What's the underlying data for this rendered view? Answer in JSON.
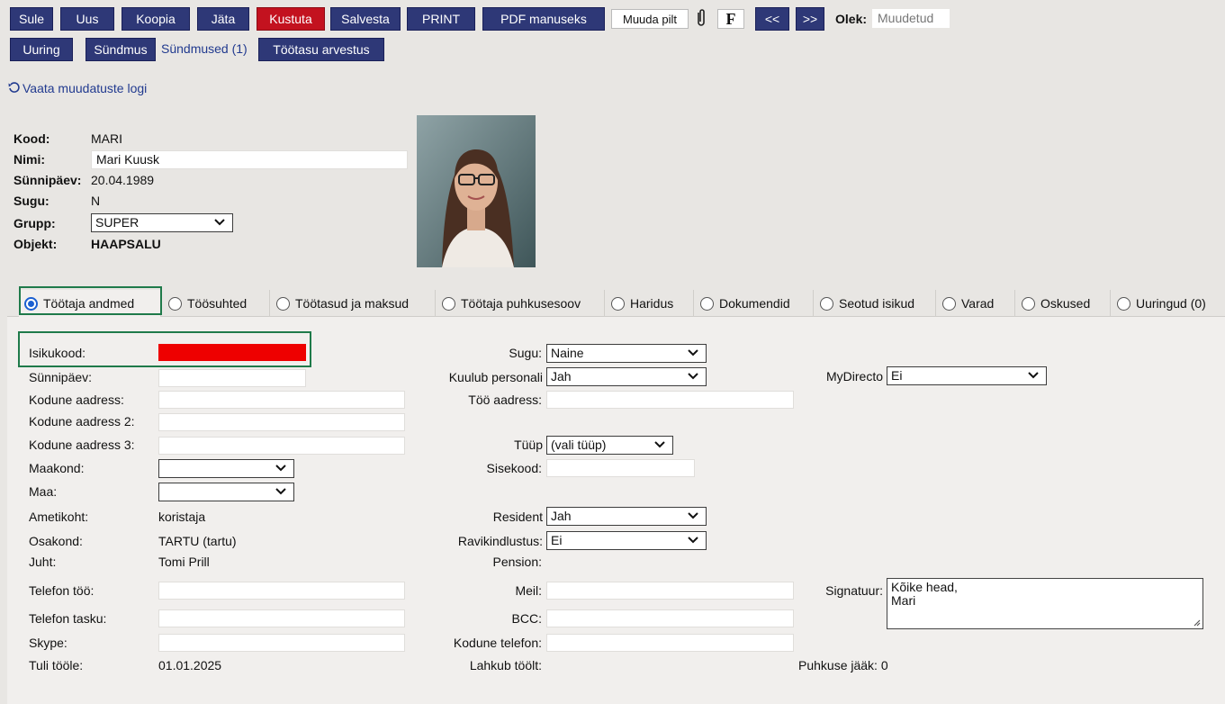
{
  "toolbar": {
    "row1": [
      "Sule",
      "Uus",
      "Koopia",
      "Jäta",
      "Kustuta",
      "Salvesta",
      "PRINT",
      "PDF manuseks"
    ],
    "change_picture": "Muuda pilt",
    "f_label": "F",
    "prev": "<<",
    "next": ">>",
    "status_label": "Olek:",
    "status_value": "Muudetud",
    "row2": [
      "Uuring",
      "Sündmus"
    ],
    "events_link": "Sündmused (1)",
    "payroll": "Töötasu arvestus"
  },
  "log_link": "Vaata muudatuste logi",
  "header": {
    "kood_label": "Kood:",
    "kood": "MARI",
    "nimi_label": "Nimi:",
    "nimi": "Mari Kuusk",
    "birthday_label": "Sünnipäev:",
    "birthday": "20.04.1989",
    "gender_label": "Sugu:",
    "gender": "N",
    "group_label": "Grupp:",
    "group": "SUPER",
    "object_label": "Objekt:",
    "object": "HAAPSALU"
  },
  "tabs": [
    "Töötaja andmed",
    "Töösuhted",
    "Töötasud ja maksud",
    "Töötaja puhkusesoov",
    "Haridus",
    "Dokumendid",
    "Seotud isikud",
    "Varad",
    "Oskused",
    "Uuringud (0)"
  ],
  "form": {
    "isikukood": "Isikukood:",
    "synnipaev": "Sünnipäev:",
    "kodune_aadress": "Kodune aadress:",
    "kodune_aadress2": "Kodune aadress 2:",
    "kodune_aadress3": "Kodune aadress 3:",
    "maakond": "Maakond:",
    "maa": "Maa:",
    "ametikoht": "Ametikoht:",
    "ametikoht_value": "koristaja",
    "osakond": "Osakond:",
    "osakond_value": "TARTU (tartu)",
    "juht": "Juht:",
    "juht_value": "Tomi Prill",
    "telefon_too": "Telefon töö:",
    "telefon_tasku": "Telefon tasku:",
    "skype": "Skype:",
    "tuli_toole": "Tuli tööle:",
    "tuli_toole_value": "01.01.2025",
    "sugu": "Sugu:",
    "sugu_value": "Naine",
    "kuulub": "Kuulub personali",
    "kuulub_value": "Jah",
    "too_aadress": "Töö aadress:",
    "tyyp": "Tüüp",
    "tyyp_value": "(vali tüüp)",
    "sisekood": "Sisekood:",
    "resident": "Resident",
    "resident_value": "Jah",
    "ravi": "Ravikindlustus:",
    "ravi_value": "Ei",
    "pension": "Pension:",
    "meil": "Meil:",
    "bcc": "BCC:",
    "kodune_telefon": "Kodune telefon:",
    "lahkub": "Lahkub töölt:",
    "mydirecto": "MyDirecto",
    "mydirecto_value": "Ei",
    "signatuur": "Signatuur:",
    "signatuur_line1": "Kõike head,",
    "signatuur_line2": "Mari",
    "puhkuse": "Puhkuse jääk: 0"
  },
  "colors": {
    "button_bg": "#2e3877",
    "delete_bg": "#c3121f",
    "highlight_border": "#1f7a4a",
    "redacted": "#ee0000"
  }
}
